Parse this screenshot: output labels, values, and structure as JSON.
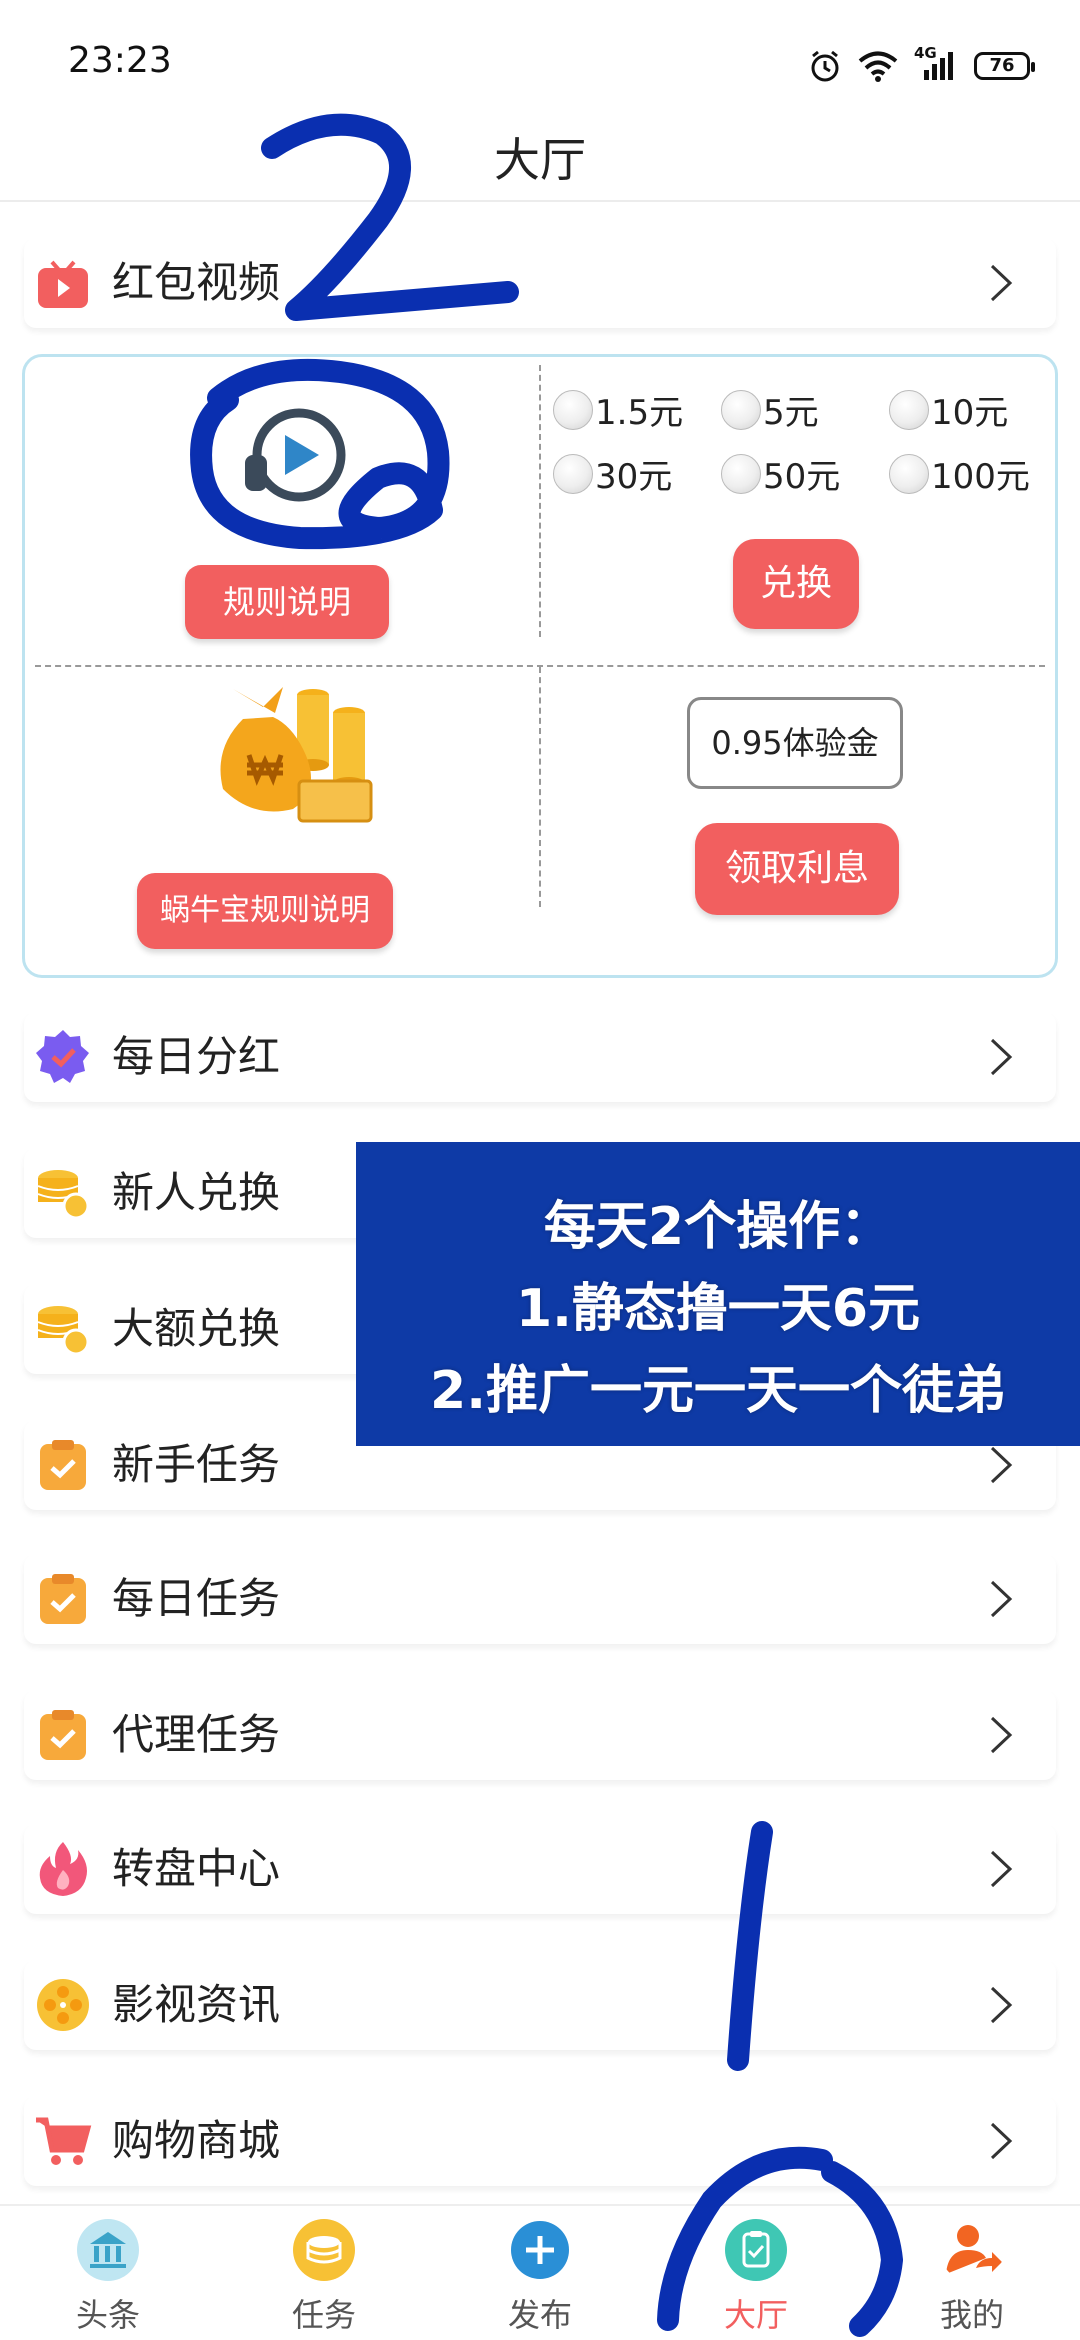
{
  "status": {
    "time": "23:23",
    "battery": "76",
    "network": "4G"
  },
  "header": {
    "title": "大厅"
  },
  "video_row": {
    "label": "红包视频"
  },
  "card": {
    "rules_button": "规则说明",
    "amounts": [
      "1.5元",
      "5元",
      "10元",
      "30元",
      "50元",
      "100元"
    ],
    "exchange_button": "兑换",
    "snail_rules_button": "蜗牛宝规则说明",
    "trial_gold": "0.95体验金",
    "collect_interest_button": "领取利息"
  },
  "menu": [
    {
      "label": "每日分红",
      "icon": "badge-check-icon"
    },
    {
      "label": "新人兑换",
      "icon": "coins-icon"
    },
    {
      "label": "大额兑换",
      "icon": "coins-icon"
    },
    {
      "label": "新手任务",
      "icon": "clipboard-check-icon"
    },
    {
      "label": "每日任务",
      "icon": "clipboard-check-icon"
    },
    {
      "label": "代理任务",
      "icon": "clipboard-check-icon"
    },
    {
      "label": "转盘中心",
      "icon": "flame-icon"
    },
    {
      "label": "影视资讯",
      "icon": "film-reel-icon"
    },
    {
      "label": "购物商城",
      "icon": "shopping-cart-icon"
    }
  ],
  "promo": {
    "line1": "每天2个操作：",
    "line2": "1.静态撸一天6元",
    "line3": "2.推广一元一天一个徒弟"
  },
  "tabs": [
    {
      "label": "头条",
      "icon": "bank-icon"
    },
    {
      "label": "任务",
      "icon": "coin-stack-icon"
    },
    {
      "label": "发布",
      "icon": "plus-icon"
    },
    {
      "label": "大厅",
      "icon": "clipboard-check-icon",
      "active": true
    },
    {
      "label": "我的",
      "icon": "user-share-icon"
    }
  ],
  "colors": {
    "accent": "#f25f5f",
    "promo_bg": "#0e3aa6",
    "card_border": "#bde3f0",
    "annotation_ink": "#0a2fb0"
  }
}
